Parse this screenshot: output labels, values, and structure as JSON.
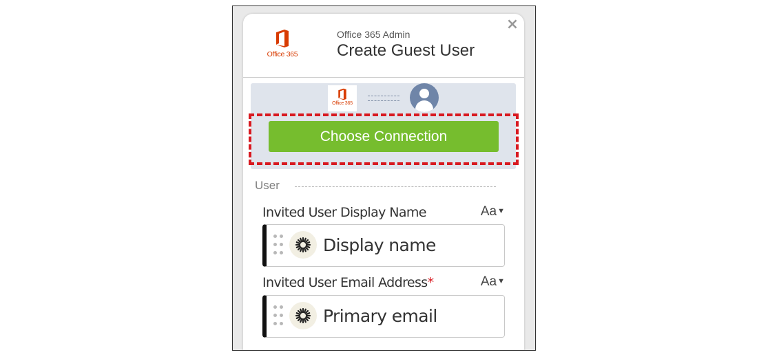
{
  "header": {
    "app_name": "Office 365 Admin",
    "title": "Create Guest User",
    "logo_text": "Office 365",
    "close_icon": "×"
  },
  "connection": {
    "logo_text": "Office 365",
    "button_label": "Choose Connection"
  },
  "section": {
    "label": "User"
  },
  "fields": [
    {
      "label": "Invited User Display Name",
      "required": false,
      "format_label": "Aa",
      "value": "Display name"
    },
    {
      "label": "Invited User Email Address",
      "required": true,
      "required_mark": "*",
      "format_label": "Aa",
      "value": "Primary email"
    }
  ],
  "colors": {
    "office_orange": "#d83b01",
    "button_green": "#76bd2e",
    "highlight_red": "#d81920",
    "avatar_blue": "#6f85a8"
  },
  "icons": {
    "office_logo": "office365-logo-icon",
    "user_avatar": "user-avatar-icon",
    "close": "close-icon",
    "field_drag": "drag-handle-icon",
    "field_source": "sunburst-icon",
    "format_caret": "caret-down-icon"
  }
}
